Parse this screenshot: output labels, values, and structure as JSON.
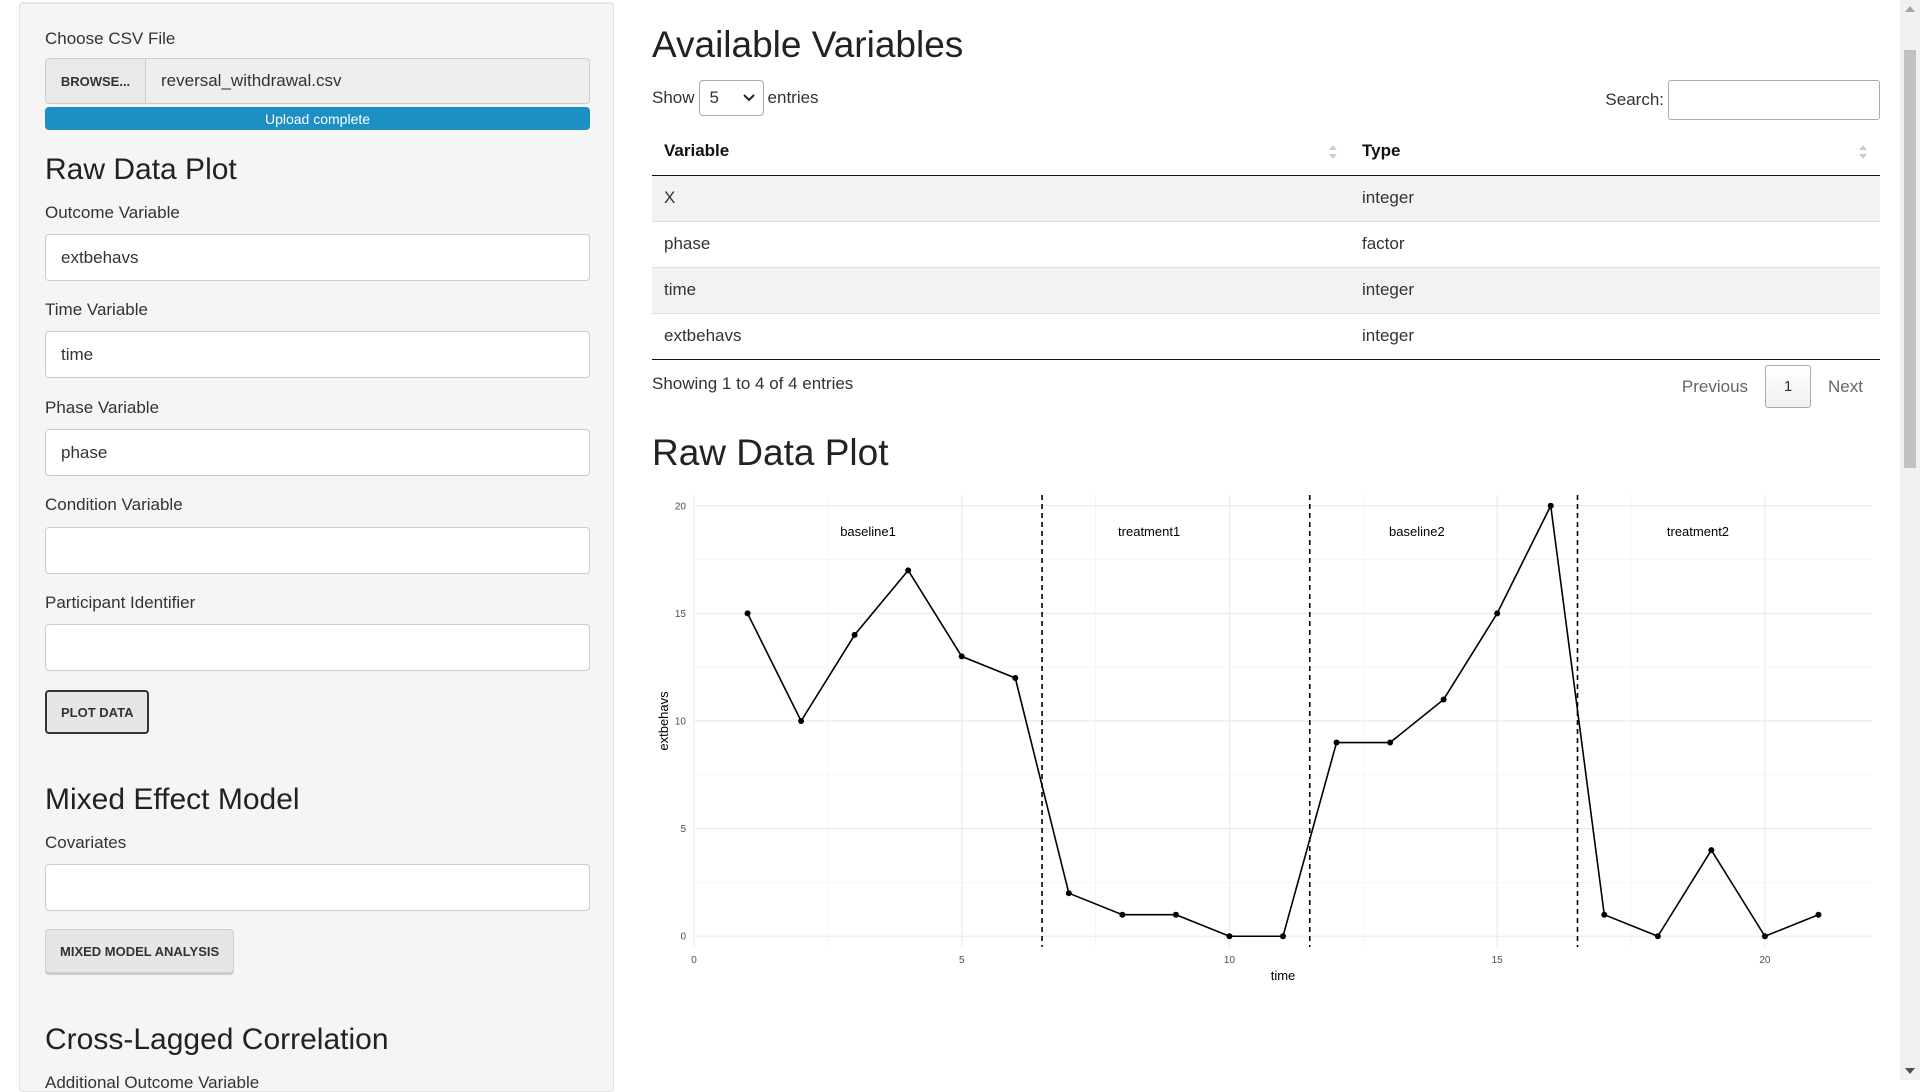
{
  "sidebar": {
    "file_label": "Choose CSV File",
    "browse_label": "Browse...",
    "file_name": "reversal_withdrawal.csv",
    "upload_status": "Upload complete",
    "upload_progress": 1.0,
    "raw_section_title": "Raw Data Plot",
    "outcome_label": "Outcome Variable",
    "outcome_value": "extbehavs",
    "time_label": "Time Variable",
    "time_value": "time",
    "phase_label": "Phase Variable",
    "phase_value": "phase",
    "condition_label": "Condition Variable",
    "condition_value": "",
    "participant_label": "Participant Identifier",
    "participant_value": "",
    "plot_button": "Plot Data",
    "mixed_section_title": "Mixed Effect Model",
    "covariates_label": "Covariates",
    "covariates_value": "",
    "mixed_button": "Mixed Model Analysis",
    "cross_section_title": "Cross-Lagged Correlation",
    "additional_outcome_label": "Additional Outcome Variable"
  },
  "main": {
    "variables_title": "Available Variables",
    "show_label": "Show",
    "entries_value": "5",
    "entries_label": "entries",
    "search_label": "Search:",
    "search_value": "",
    "columns": [
      "Variable",
      "Type"
    ],
    "rows": [
      [
        "X",
        "integer"
      ],
      [
        "phase",
        "factor"
      ],
      [
        "time",
        "integer"
      ],
      [
        "extbehavs",
        "integer"
      ]
    ],
    "info": "Showing 1 to 4 of 4 entries",
    "pager": {
      "previous": "Previous",
      "current": "1",
      "next": "Next"
    },
    "plot_title": "Raw Data Plot"
  },
  "chart_data": {
    "type": "line",
    "xlabel": "time",
    "ylabel": "extbehavs",
    "xlim": [
      0,
      22
    ],
    "ylim": [
      -0.5,
      20.5
    ],
    "x_ticks": [
      0,
      5,
      10,
      15,
      20
    ],
    "y_ticks": [
      0,
      5,
      10,
      15,
      20
    ],
    "grid": true,
    "x": [
      1,
      2,
      3,
      4,
      5,
      6,
      7,
      8,
      9,
      10,
      11,
      12,
      13,
      14,
      15,
      16,
      17,
      18,
      19,
      20,
      21
    ],
    "y": [
      15,
      10,
      14,
      17,
      13,
      12,
      2,
      1,
      1,
      0,
      0,
      9,
      9,
      11,
      15,
      20,
      1,
      0,
      4,
      0,
      1
    ],
    "phase_lines": [
      6.5,
      11.5,
      16.5
    ],
    "phase_labels": [
      {
        "label": "baseline1",
        "x": 3.25,
        "y": 18.6
      },
      {
        "label": "treatment1",
        "x": 8.5,
        "y": 18.6
      },
      {
        "label": "baseline2",
        "x": 13.5,
        "y": 18.6
      },
      {
        "label": "treatment2",
        "x": 18.75,
        "y": 18.6
      }
    ],
    "line_color": "#000000"
  }
}
